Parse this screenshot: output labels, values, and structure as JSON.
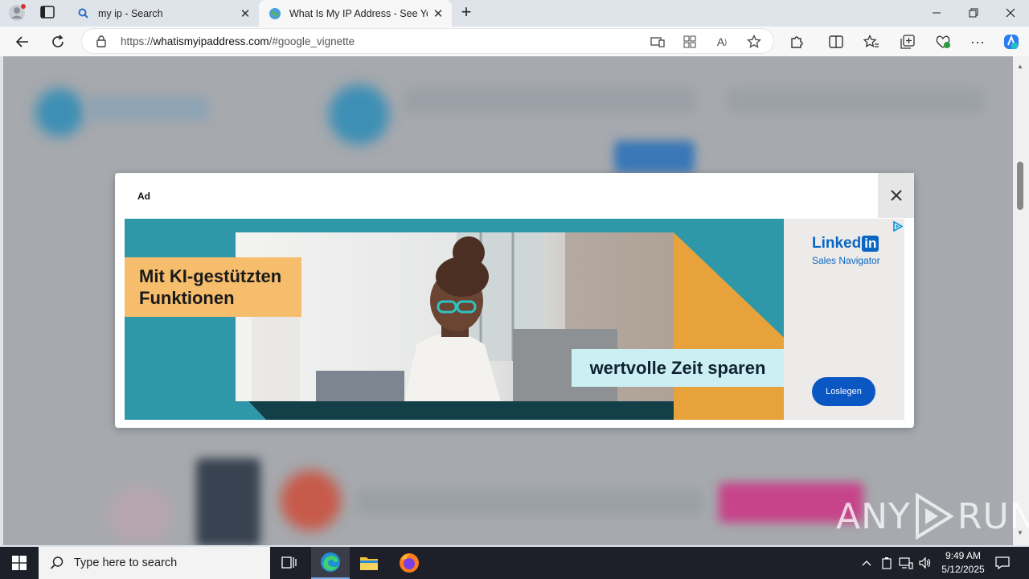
{
  "browser": {
    "tabs": [
      {
        "title": "my ip - Search",
        "icon": "search-icon",
        "active": false
      },
      {
        "title": "What Is My IP Address - See Your",
        "icon": "globe-icon",
        "active": true
      }
    ],
    "new_tab_label": "+",
    "url_prefix": "https://",
    "url_host": "whatismyipaddress.com",
    "url_rest": "/#google_vignette"
  },
  "ad": {
    "label": "Ad",
    "headline_line1": "Mit KI-gestützten",
    "headline_line2": "Funktionen",
    "tagline": "wertvolle Zeit sparen",
    "brand_name": "Linked",
    "brand_in": "in",
    "brand_product": "Sales Navigator",
    "cta": "Loslegen",
    "colors": {
      "teal": "#2f98a8",
      "orange": "#e8a23c",
      "linkedin_blue": "#0a66c2"
    }
  },
  "watermark": {
    "left": "ANY",
    "right": "RUN"
  },
  "taskbar": {
    "search_placeholder": "Type here to search",
    "time": "9:49 AM",
    "date": "5/12/2025"
  }
}
